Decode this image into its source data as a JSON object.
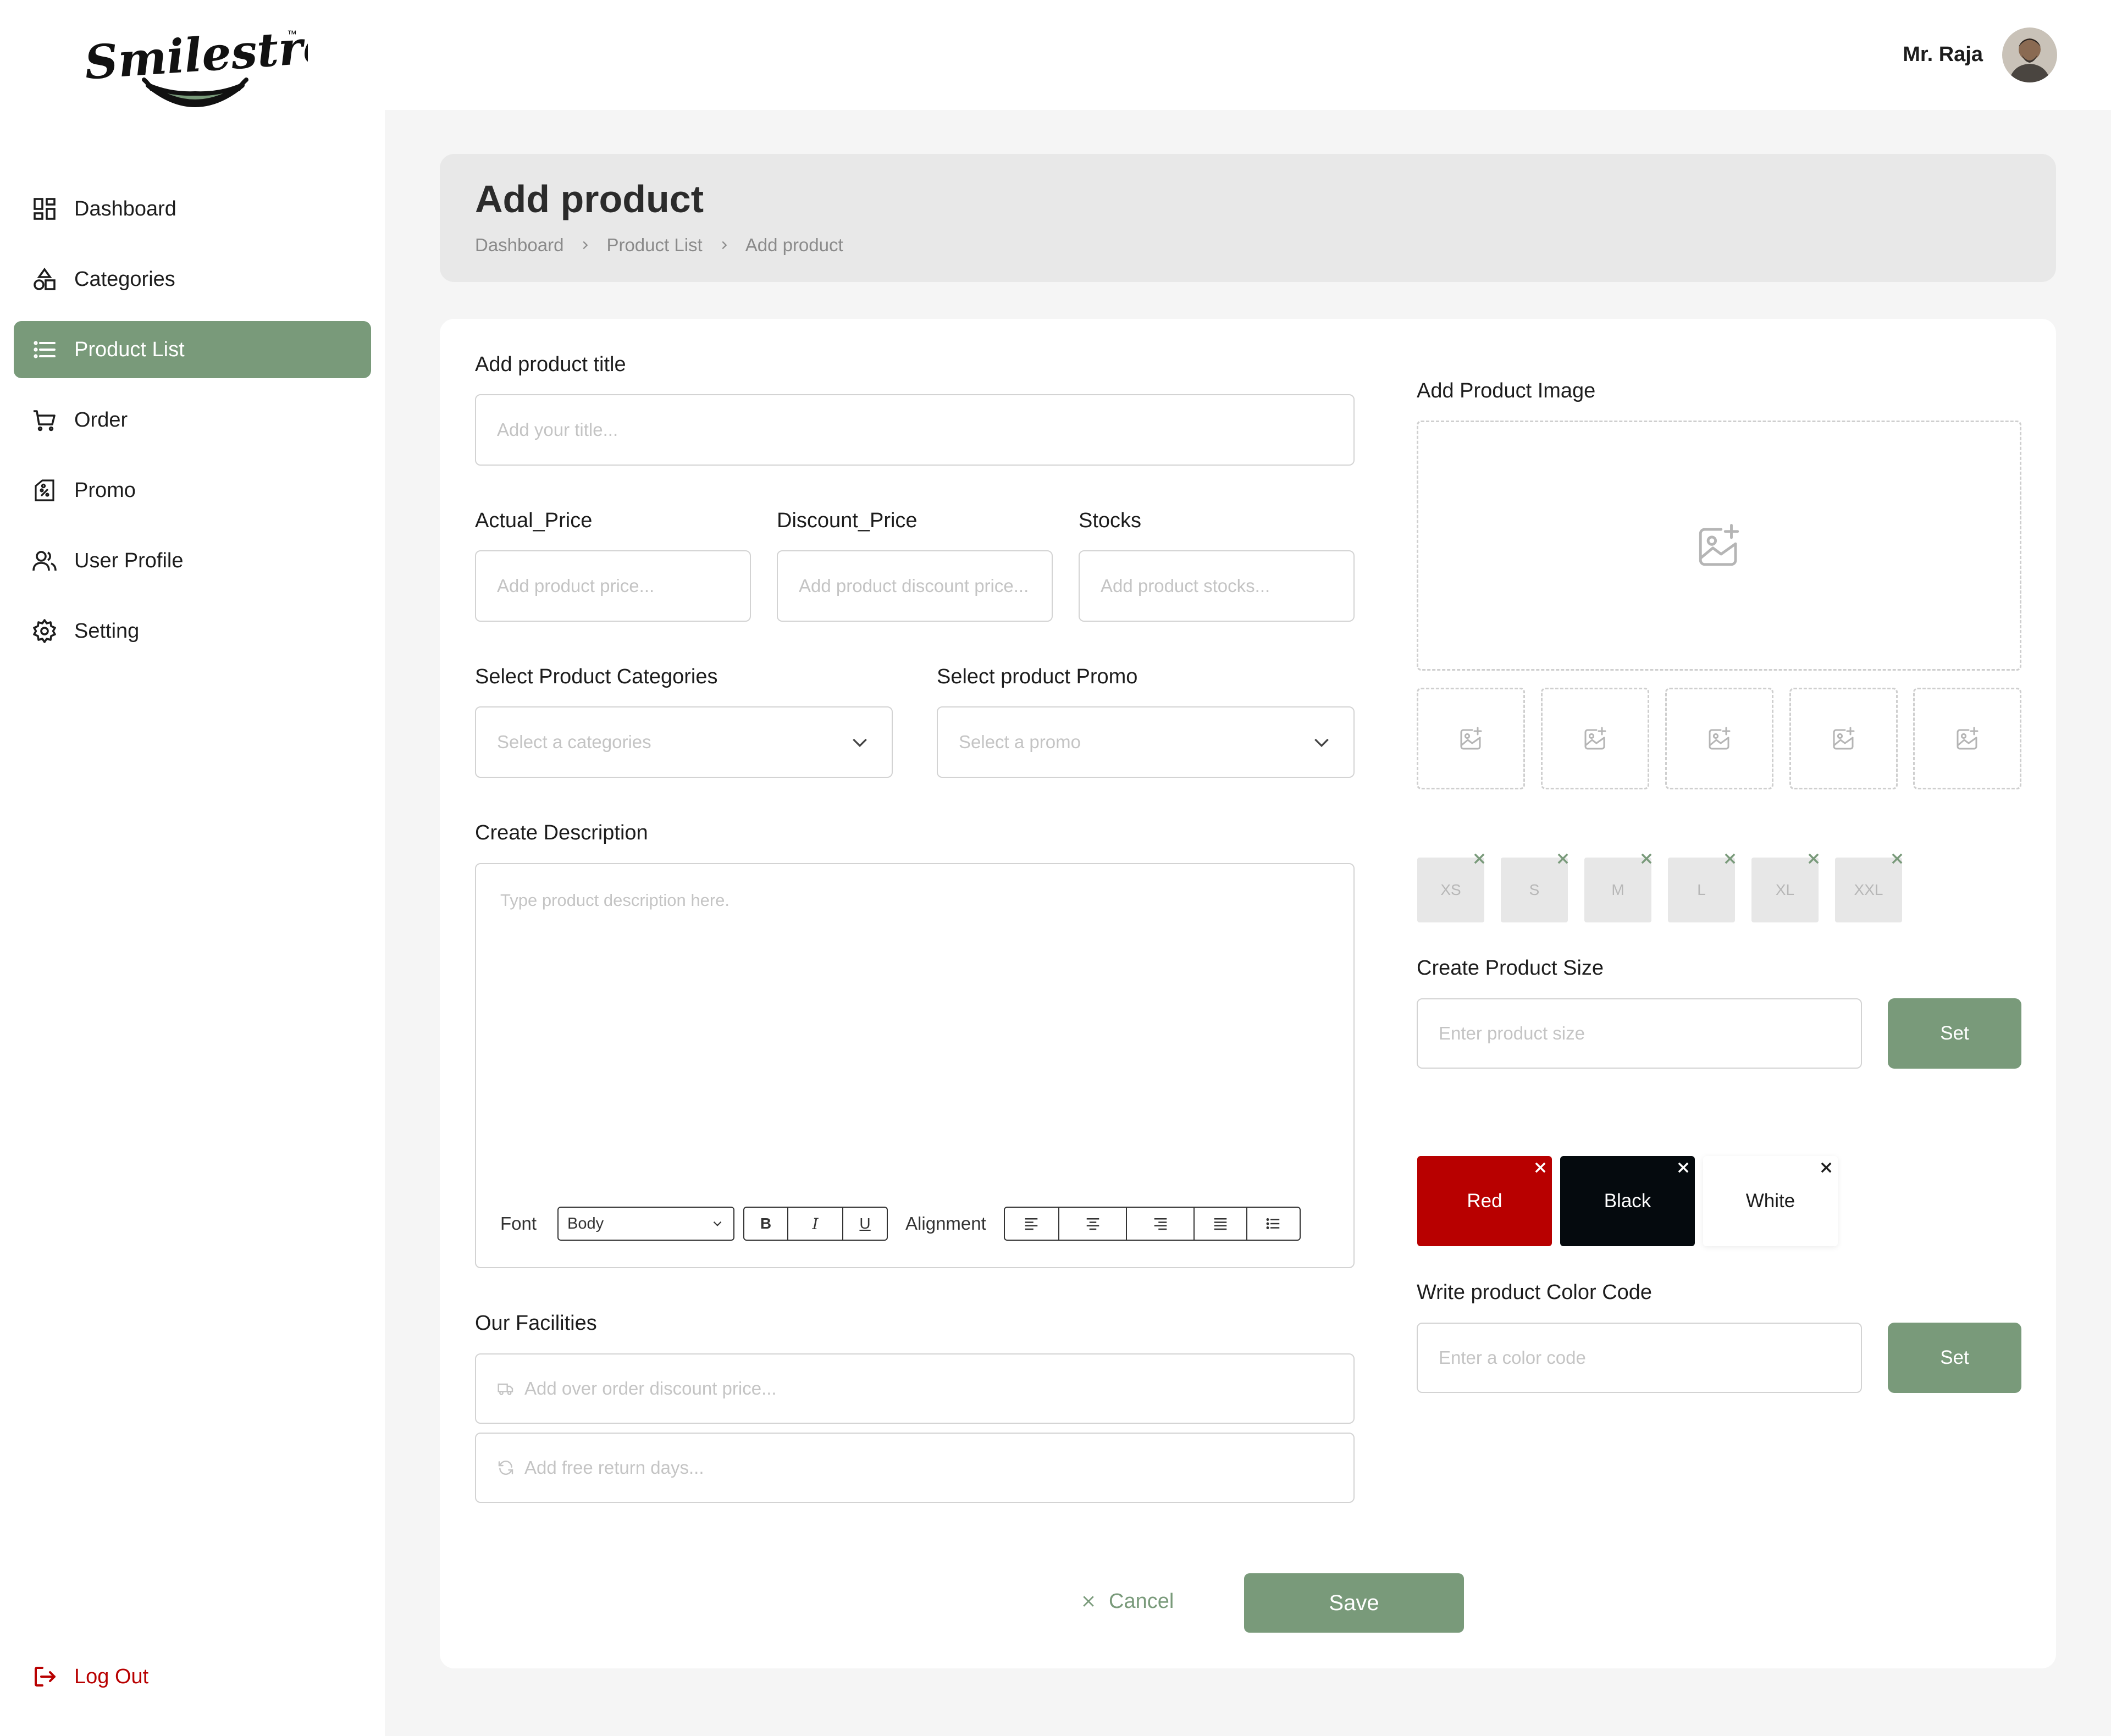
{
  "brand": {
    "logo_text": "Smilestreats",
    "trademark": "™",
    "accent_color": "#799a7a",
    "logout_color": "#b80000"
  },
  "user": {
    "name": "Mr. Raja"
  },
  "sidebar": {
    "items": [
      {
        "label": "Dashboard",
        "icon": "dashboard-icon",
        "active": false
      },
      {
        "label": "Categories",
        "icon": "categories-icon",
        "active": false
      },
      {
        "label": "Product List",
        "icon": "list-icon",
        "active": true
      },
      {
        "label": "Order",
        "icon": "cart-icon",
        "active": false
      },
      {
        "label": "Promo",
        "icon": "promo-icon",
        "active": false
      },
      {
        "label": "User Profile",
        "icon": "user-icon",
        "active": false
      },
      {
        "label": "Setting",
        "icon": "gear-icon",
        "active": false
      }
    ],
    "logout": "Log Out"
  },
  "header": {
    "title": "Add product",
    "breadcrumb": [
      "Dashboard",
      "Product List",
      "Add product"
    ]
  },
  "form": {
    "title": {
      "label": "Add product title",
      "placeholder": "Add your title..."
    },
    "actual_price": {
      "label": "Actual_Price",
      "placeholder": "Add product price..."
    },
    "discount_price": {
      "label": "Discount_Price",
      "placeholder": "Add product discount price..."
    },
    "stocks": {
      "label": "Stocks",
      "placeholder": "Add product stocks..."
    },
    "categories": {
      "label": "Select Product Categories",
      "placeholder": "Select a categories"
    },
    "promo": {
      "label": "Select product Promo",
      "placeholder": "Select a promo"
    },
    "description": {
      "label": "Create Description",
      "placeholder": "Type product description here.",
      "toolbar": {
        "font_label": "Font",
        "font_value": "Body",
        "bold": "B",
        "italic": "I",
        "underline": "U",
        "alignment_label": "Alignment"
      }
    },
    "facilities": {
      "label": "Our Facilities",
      "discount_placeholder": "Add over order discount price...",
      "return_placeholder": "Add free return days..."
    },
    "image": {
      "label": "Add Product Image"
    },
    "sizes": {
      "chips": [
        "XS",
        "S",
        "M",
        "L",
        "XL",
        "XXL"
      ],
      "label": "Create Product Size",
      "placeholder": "Enter product size",
      "set_label": "Set"
    },
    "colors": {
      "chips": [
        {
          "name": "Red",
          "bg": "#b80000",
          "fg": "#ffffff"
        },
        {
          "name": "Black",
          "bg": "#050a0e",
          "fg": "#ffffff"
        },
        {
          "name": "White",
          "bg": "#ffffff",
          "fg": "#1d1d1d"
        }
      ],
      "label": "Write product Color Code",
      "placeholder": "Enter a color code",
      "set_label": "Set"
    },
    "actions": {
      "cancel": "Cancel",
      "save": "Save"
    }
  }
}
